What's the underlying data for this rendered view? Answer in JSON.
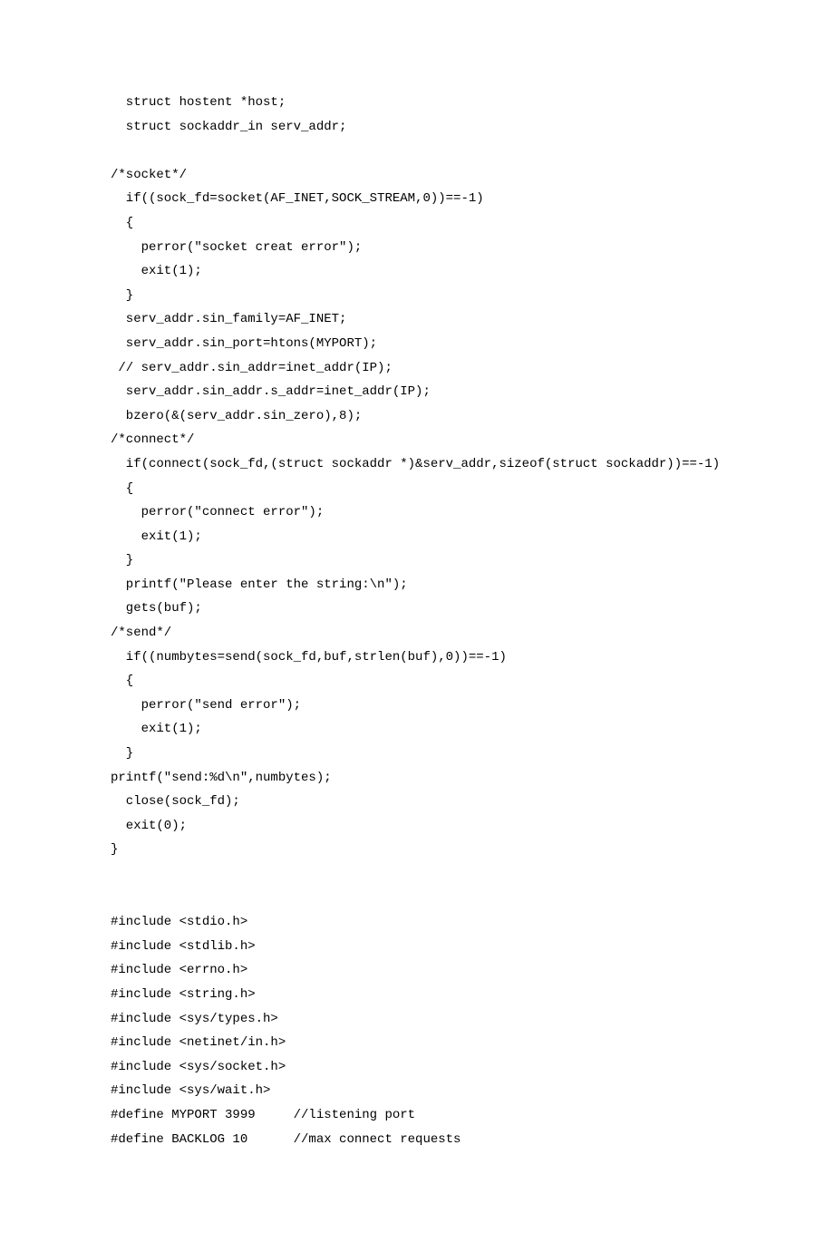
{
  "code": {
    "lines": [
      "  struct hostent *host;",
      "  struct sockaddr_in serv_addr;",
      "",
      "/*socket*/",
      "  if((sock_fd=socket(AF_INET,SOCK_STREAM,0))==-1)",
      "  {",
      "    perror(\"socket creat error\");",
      "    exit(1);",
      "  }",
      "  serv_addr.sin_family=AF_INET;",
      "  serv_addr.sin_port=htons(MYPORT);",
      " // serv_addr.sin_addr=inet_addr(IP);",
      "  serv_addr.sin_addr.s_addr=inet_addr(IP);",
      "  bzero(&(serv_addr.sin_zero),8);",
      "/*connect*/",
      "  if(connect(sock_fd,(struct sockaddr *)&serv_addr,sizeof(struct sockaddr))==-1)",
      "  {",
      "    perror(\"connect error\");",
      "    exit(1);",
      "  }",
      "  printf(\"Please enter the string:\\n\");",
      "  gets(buf);",
      "/*send*/",
      "  if((numbytes=send(sock_fd,buf,strlen(buf),0))==-1)",
      "  {",
      "    perror(\"send error\");",
      "    exit(1);",
      "  }",
      "printf(\"send:%d\\n\",numbytes);",
      "  close(sock_fd);",
      "  exit(0);",
      "}",
      "",
      "",
      "#include <stdio.h>",
      "#include <stdlib.h>",
      "#include <errno.h>",
      "#include <string.h>",
      "#include <sys/types.h>",
      "#include <netinet/in.h>",
      "#include <sys/socket.h>",
      "#include <sys/wait.h>",
      "#define MYPORT 3999     //listening port",
      "#define BACKLOG 10      //max connect requests"
    ]
  }
}
